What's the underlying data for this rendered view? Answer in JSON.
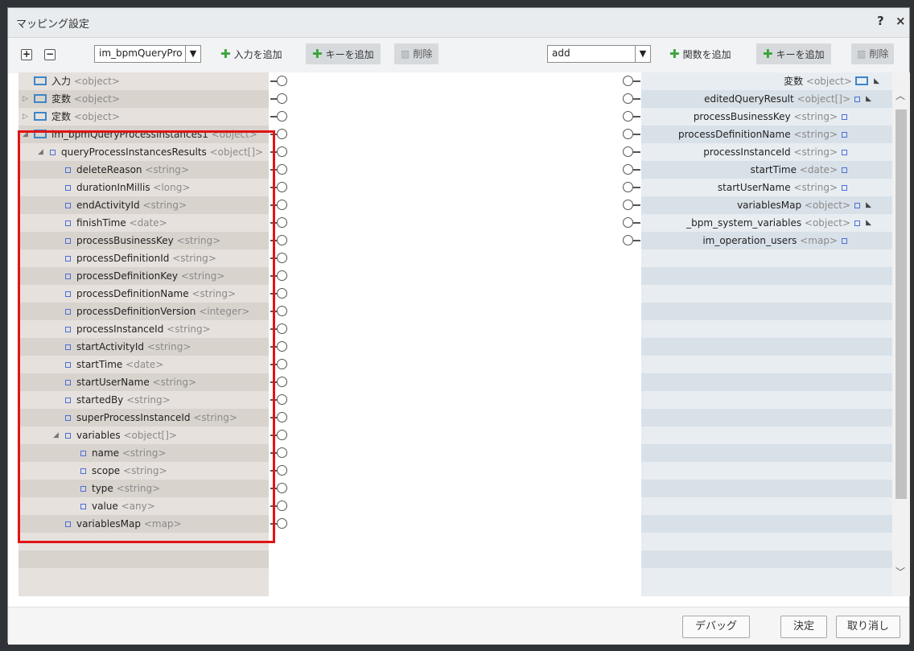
{
  "dialog": {
    "title": "マッピング設定",
    "help": "?",
    "close": "×"
  },
  "toolbar": {
    "expand": "+",
    "collapse": "−",
    "input_select": "im_bpmQueryPro",
    "add_input": "入力を追加",
    "add_key_left": "キーを追加",
    "delete_left": "削除",
    "func_select": "add",
    "add_function": "関数を追加",
    "add_key_right": "キーを追加",
    "delete_right": "削除"
  },
  "left_tree": [
    {
      "label": "入力",
      "type": "<object>",
      "icon": "folder-icon",
      "expander": ""
    },
    {
      "label": "変数",
      "type": "<object>",
      "icon": "folder-icon",
      "expander": "▷"
    },
    {
      "label": "定数",
      "type": "<object>",
      "icon": "folder-icon",
      "expander": "▷"
    },
    {
      "label": "im_bpmQueryProcessInstances1",
      "type": "<object>",
      "icon": "folder-icon",
      "expander": "◢"
    },
    {
      "label": "queryProcessInstancesResults",
      "type": "<object[]>",
      "icon": "field-icon",
      "expander": "◢"
    },
    {
      "label": "deleteReason",
      "type": "<string>",
      "icon": "field-icon",
      "expander": ""
    },
    {
      "label": "durationInMillis",
      "type": "<long>",
      "icon": "field-icon",
      "expander": ""
    },
    {
      "label": "endActivityId",
      "type": "<string>",
      "icon": "field-icon",
      "expander": ""
    },
    {
      "label": "finishTime",
      "type": "<date>",
      "icon": "field-icon",
      "expander": ""
    },
    {
      "label": "processBusinessKey",
      "type": "<string>",
      "icon": "field-icon",
      "expander": ""
    },
    {
      "label": "processDefinitionId",
      "type": "<string>",
      "icon": "field-icon",
      "expander": ""
    },
    {
      "label": "processDefinitionKey",
      "type": "<string>",
      "icon": "field-icon",
      "expander": ""
    },
    {
      "label": "processDefinitionName",
      "type": "<string>",
      "icon": "field-icon",
      "expander": ""
    },
    {
      "label": "processDefinitionVersion",
      "type": "<integer>",
      "icon": "field-icon",
      "expander": ""
    },
    {
      "label": "processInstanceId",
      "type": "<string>",
      "icon": "field-icon",
      "expander": ""
    },
    {
      "label": "startActivityId",
      "type": "<string>",
      "icon": "field-icon",
      "expander": ""
    },
    {
      "label": "startTime",
      "type": "<date>",
      "icon": "field-icon",
      "expander": ""
    },
    {
      "label": "startUserName",
      "type": "<string>",
      "icon": "field-icon",
      "expander": ""
    },
    {
      "label": "startedBy",
      "type": "<string>",
      "icon": "field-icon",
      "expander": ""
    },
    {
      "label": "superProcessInstanceId",
      "type": "<string>",
      "icon": "field-icon",
      "expander": ""
    },
    {
      "label": "variables",
      "type": "<object[]>",
      "icon": "field-icon",
      "expander": "◢"
    },
    {
      "label": "name",
      "type": "<string>",
      "icon": "field-icon",
      "expander": ""
    },
    {
      "label": "scope",
      "type": "<string>",
      "icon": "field-icon",
      "expander": ""
    },
    {
      "label": "type",
      "type": "<string>",
      "icon": "field-icon",
      "expander": ""
    },
    {
      "label": "value",
      "type": "<any>",
      "icon": "field-icon",
      "expander": ""
    },
    {
      "label": "variablesMap",
      "type": "<map>",
      "icon": "field-icon",
      "expander": ""
    }
  ],
  "right_tree": [
    {
      "label": "変数",
      "type": "<object>",
      "icon": "folder-icon",
      "marker": "◣"
    },
    {
      "label": "editedQueryResult",
      "type": "<object[]>",
      "icon": "field-icon",
      "marker": "◣"
    },
    {
      "label": "processBusinessKey",
      "type": "<string>",
      "icon": "field-icon",
      "marker": ""
    },
    {
      "label": "processDefinitionName",
      "type": "<string>",
      "icon": "field-icon",
      "marker": ""
    },
    {
      "label": "processInstanceId",
      "type": "<string>",
      "icon": "field-icon",
      "marker": ""
    },
    {
      "label": "startTime",
      "type": "<date>",
      "icon": "field-icon",
      "marker": ""
    },
    {
      "label": "startUserName",
      "type": "<string>",
      "icon": "field-icon",
      "marker": ""
    },
    {
      "label": "variablesMap",
      "type": "<object>",
      "icon": "field-icon",
      "marker": "◣"
    },
    {
      "label": "_bpm_system_variables",
      "type": "<object>",
      "icon": "field-icon",
      "marker": "◣"
    },
    {
      "label": "im_operation_users",
      "type": "<map>",
      "icon": "field-icon",
      "marker": ""
    }
  ],
  "footer": {
    "debug": "デバッグ",
    "ok": "決定",
    "cancel": "取り消し"
  }
}
